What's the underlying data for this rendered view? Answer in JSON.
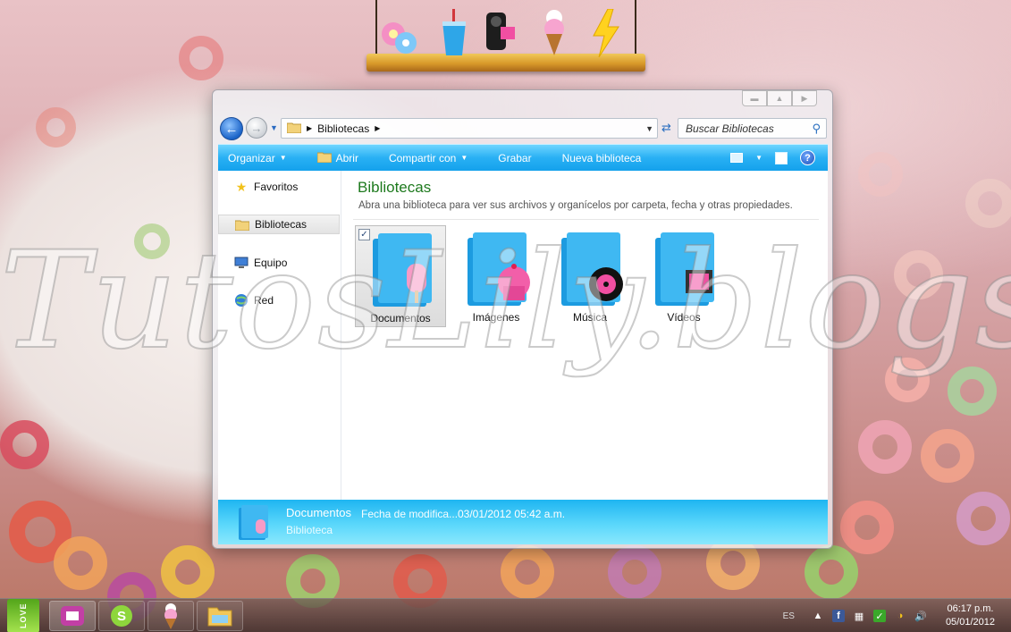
{
  "desktop": {
    "watermark": "TutosLily.blogspot.com"
  },
  "shelf": {
    "items": [
      "flowers-icon",
      "soda-cup-icon",
      "camera-icon",
      "ice-cream-icon",
      "lightning-icon"
    ]
  },
  "window": {
    "caption_buttons": [
      "minimize",
      "maximize",
      "close"
    ],
    "address": {
      "path": [
        "Bibliotecas"
      ]
    },
    "search": {
      "placeholder": "Buscar Bibliotecas"
    },
    "toolbar": {
      "organize": "Organizar",
      "open": "Abrir",
      "share": "Compartir con",
      "burn": "Grabar",
      "new_library": "Nueva biblioteca"
    },
    "nav_pane": {
      "items": [
        {
          "label": "Favoritos",
          "icon": "star-icon"
        },
        {
          "label": "Bibliotecas",
          "icon": "libraries-icon",
          "selected": true
        },
        {
          "label": "Equipo",
          "icon": "computer-icon"
        },
        {
          "label": "Red",
          "icon": "network-icon"
        }
      ]
    },
    "main": {
      "title": "Bibliotecas",
      "description": "Abra una biblioteca para ver sus archivos y organícelos por carpeta, fecha y otras propiedades.",
      "libraries": [
        {
          "label": "Documentos",
          "icon": "popsicle-folder-icon",
          "selected": true
        },
        {
          "label": "Imágenes",
          "icon": "cupcake-folder-icon"
        },
        {
          "label": "Música",
          "icon": "music-folder-icon"
        },
        {
          "label": "Vídeos",
          "icon": "film-folder-icon"
        }
      ]
    },
    "details": {
      "name": "Documentos",
      "type": "Biblioteca",
      "field_label": "Fecha de modifica...",
      "field_value": "03/01/2012 05:42 a.m."
    }
  },
  "taskbar": {
    "start_label": "LOVE",
    "pinned": [
      "media-player-icon",
      "skype-icon",
      "ice-cream-icon",
      "explorer-icon"
    ],
    "tray": {
      "language": "ES",
      "time": "06:17 p.m.",
      "date": "05/01/2012"
    }
  },
  "colors": {
    "toolbar": "#29b0f4",
    "details_pane": "#5ad7fb",
    "library_title": "#1e7a1e"
  }
}
